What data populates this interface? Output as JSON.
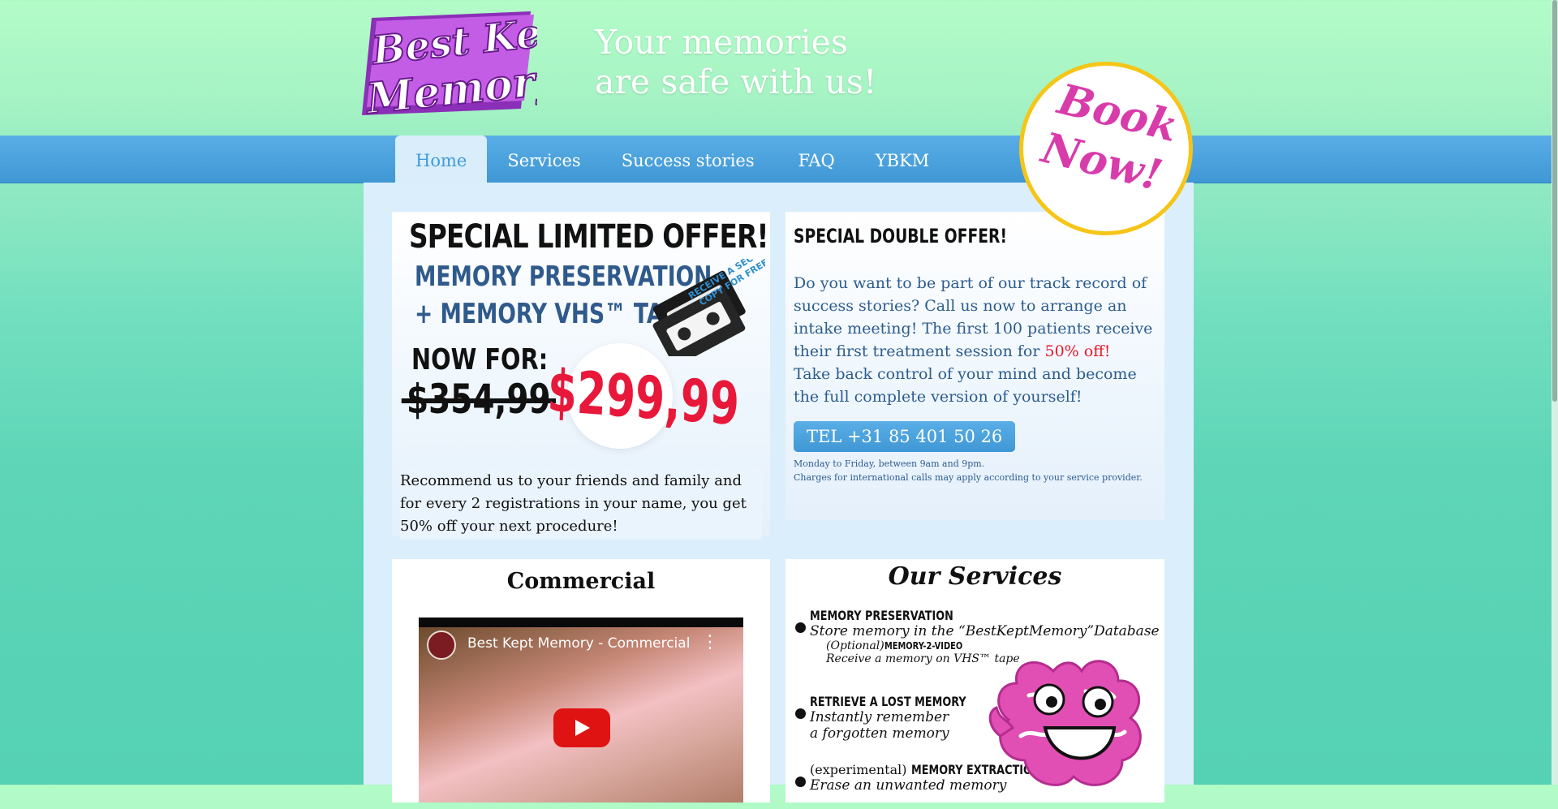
{
  "header": {
    "logo_line1": "Best Kept",
    "logo_line2": "Memory",
    "tagline_line1": "Your memories",
    "tagline_line2": "are safe with us!"
  },
  "nav": {
    "items": [
      "Home",
      "Services",
      "Success stories",
      "FAQ",
      "YBKM"
    ],
    "active": "Home"
  },
  "book_now": {
    "line1": "Book",
    "line2": "Now!"
  },
  "offer": {
    "heading": "SPECIAL LIMITED OFFER!",
    "line1": "MEMORY PRESERVATION",
    "line2": "+ MEMORY VHS™ TAPE",
    "now_for": "NOW FOR:",
    "old_price": "$354,99",
    "new_price": "$299,99",
    "vhs_badge_line1": "RECEIVE A SECOND",
    "vhs_badge_line2": "COPY FOR FREE!!",
    "recommend_text": "Recommend us to your friends and family and for every 2 registrations in your name, you get 50% off your next procedure!"
  },
  "double_offer": {
    "heading": "SPECIAL DOUBLE OFFER!",
    "body_before": "Do you want to be part of our track record of success stories? Call us now to arrange an intake meeting! The first 100 patients receive their first treatment session for ",
    "body_highlight": "50% off!",
    "body_after": "Take back control of your mind and become the full complete version of yourself!",
    "tel_button": "TEL +31 85 401 50 26",
    "note_line1": "Monday to Friday, between 9am and 9pm.",
    "note_line2": "Charges for international calls may apply according to your service provider."
  },
  "commercial": {
    "title": "Commercial",
    "video_title": "Best Kept Memory - Commercial",
    "video_menu": "⋮"
  },
  "services": {
    "title": "Our Services",
    "item1_name": "MEMORY PRESERVATION",
    "item1_desc": "Store memory in the “BestKeptMemory”Database",
    "item1_opt_prefix": "(Optional)",
    "item1_opt_name": "MEMORY-2-VIDEO",
    "item1_opt_desc": "Receive a memory on VHS™ tape",
    "item2_name": "RETRIEVE A LOST MEMORY",
    "item2_desc_line1": "Instantly remember",
    "item2_desc_line2": "a forgotten memory",
    "item3_prefix": "(experimental)",
    "item3_name": "MEMORY EXTRACTION",
    "item3_desc": "Erase an unwanted memory"
  },
  "colors": {
    "nav_blue": "#3f97d4",
    "accent_pink": "#d83cab",
    "price_red": "#e8183a",
    "book_ring": "#f5c518"
  }
}
